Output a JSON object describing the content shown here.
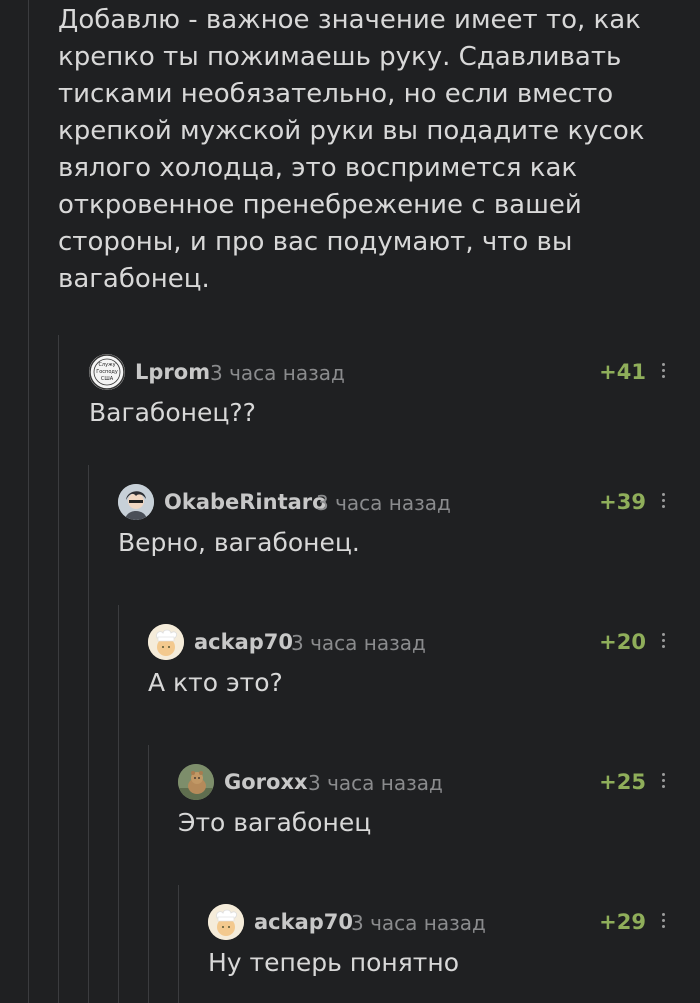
{
  "post": {
    "text": "Добавлю - важное значение имеет то, как крепко ты пожимаешь руку. Сдавливать тисками необязательно, но если вместо крепкой мужской руки вы подадите кусок вялого холодца, это воспримется как откровенное пренебрежение с вашей стороны, и про вас подумают, что вы вагабонец."
  },
  "comments": [
    {
      "username": "Lprom",
      "time": "3 часа назад",
      "rating": "+41",
      "text": "Вагабонец??",
      "avatar_icon": "badge-avatar-icon",
      "avatar_text": [
        "Служу",
        "Господу",
        "США"
      ]
    },
    {
      "username": "OkabeRintaro",
      "time": "3 часа назад",
      "rating": "+39",
      "text": "Верно, вагабонец.",
      "avatar_icon": "anime-character-avatar-icon"
    },
    {
      "username": "ackap70",
      "time": "3 часа назад",
      "rating": "+20",
      "text": "А кто это?",
      "avatar_icon": "chef-avatar-icon"
    },
    {
      "username": "Goroxx",
      "time": "3 часа назад",
      "rating": "+25",
      "text": "Это вагабонец",
      "avatar_icon": "animal-avatar-icon"
    },
    {
      "username": "ackap70",
      "time": "3 часа назад",
      "rating": "+29",
      "text": "Ну теперь понятно",
      "avatar_icon": "chef-avatar-icon"
    }
  ],
  "colors": {
    "background": "#1f2022",
    "text": "#d8d8d8",
    "muted": "#8a8b8d",
    "rating": "#8fae5a",
    "thread_line": "#3b3c3f"
  }
}
